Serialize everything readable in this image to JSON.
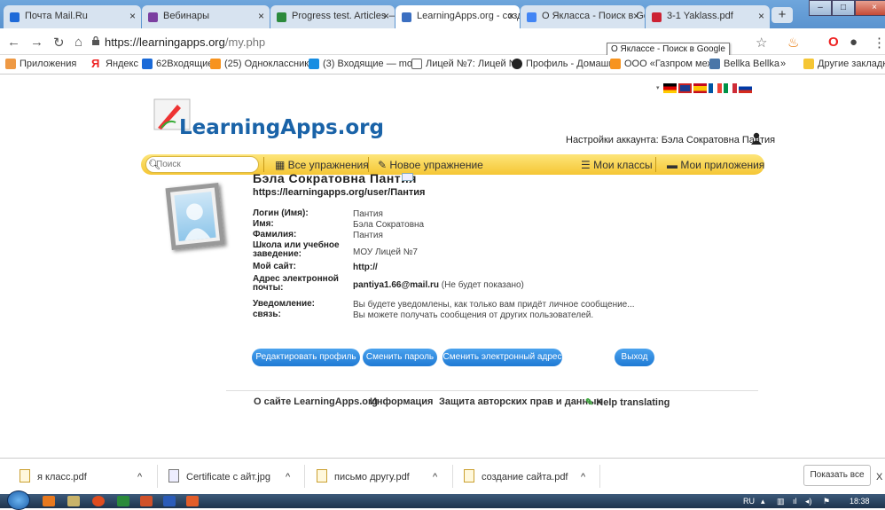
{
  "browser": {
    "tabs": [
      {
        "label": "Почта Mail.Ru",
        "color": "#1e6ad8"
      },
      {
        "label": "Вебинары",
        "color": "#7b3fa0"
      },
      {
        "label": "Progress test. Articles —",
        "color": "#2c8a3c"
      },
      {
        "label": "LearningApps.org - созд",
        "color": "#3b6fc1"
      },
      {
        "label": "О Якласса - Поиск в Go",
        "color": "#4285f4"
      },
      {
        "label": "3-1 Yaklass.pdf",
        "color": "#c23"
      }
    ],
    "tab_close": "×",
    "new_tab": "+",
    "url_host": "https://learningapps.org",
    "url_path": "/my.php",
    "tooltip": "О Яклассе - Поиск в Google",
    "bookmarks": [
      {
        "label": "Приложения",
        "color": "#e94"
      },
      {
        "label": "Яндекс",
        "color": "#e22"
      },
      {
        "label": "62Входящие",
        "color": "#1a6ad8"
      },
      {
        "label": "(25) Одноклассники",
        "color": "#f7931e"
      },
      {
        "label": "(3) Входящие — mo",
        "color": "#168de2"
      },
      {
        "label": "Лицей №7: Лицей N",
        "color": "#666"
      },
      {
        "label": "Профиль - Домашни",
        "color": "#222"
      },
      {
        "label": "ООО «Газпром меж",
        "color": "#f7931e"
      },
      {
        "label": "Bellka Bellka",
        "color": "#4a76a8"
      }
    ],
    "bookmarks_more": "»",
    "other_bookmarks": "Другие закладки"
  },
  "site": {
    "logo": "LearningApps.org",
    "account_label": "Настройки аккаунта: Бэла Сократовна Пантия",
    "search_placeholder": "Поиск",
    "menu": {
      "all": "Все упражнения",
      "new": "Новое упражнение",
      "classes": "Мои классы",
      "apps": "Мои приложения"
    }
  },
  "profile": {
    "name": "Бэла Сократовна Пантия",
    "url": "https://learningapps.org/user/Пантия",
    "fields": [
      {
        "label": "Логин (Имя):",
        "value": "Пантия"
      },
      {
        "label": "Имя:",
        "value": "Бэла Сократовна"
      },
      {
        "label": "Фамилия:",
        "value": "Пантия"
      },
      {
        "label": "Школа или учебное заведение:",
        "value": "МОУ Лицей №7"
      },
      {
        "label": "Мой сайт:",
        "value": "http://"
      },
      {
        "label": "Адрес электронной почты:",
        "value": "pantiya1.66@mail.ru",
        "note": "(Не будет показано)"
      },
      {
        "label": "Уведомление:",
        "value": "Вы будете уведомлены, как только вам придёт личное сообщение..."
      },
      {
        "label": "связь:",
        "value": "Вы можете получать сообщения от других пользователей."
      }
    ],
    "buttons": {
      "edit": "Редактировать профиль",
      "password": "Сменить пароль",
      "email": "Сменить электронный адрес",
      "logout": "Выход"
    }
  },
  "footer": {
    "about": "О сайте LearningApps.org",
    "info": "Информация",
    "copyright": "Защита авторских прав и данных",
    "translate": "Help translating"
  },
  "downloads": {
    "items": [
      "я класс.pdf",
      "Certificate с айт.jpg",
      "письмо другу.pdf",
      "создание сайта.pdf"
    ],
    "show_all": "Показать все",
    "close": "X"
  },
  "taskbar": {
    "lang": "RU",
    "time": "18:38"
  }
}
